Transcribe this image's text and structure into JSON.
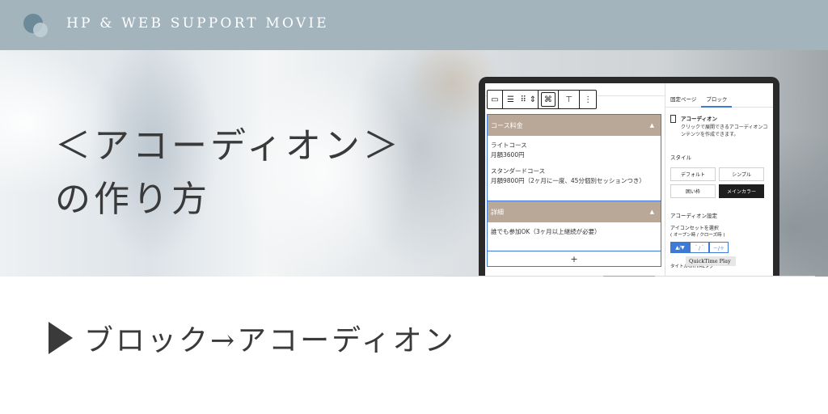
{
  "header": {
    "title": "HP & WEB SUPPORT MOVIE"
  },
  "hero": {
    "title_line1": "＜アコーディオン＞",
    "title_line2": "の作り方"
  },
  "editor": {
    "accordion1": {
      "heading": "コース料金",
      "lines": [
        "ライトコース",
        "月額3600円",
        "スタンダードコース",
        "月額9800円（2ヶ月に一度、45分個別セッションつき）"
      ]
    },
    "accordion2": {
      "heading": "詳細",
      "lines": [
        "誰でも参加OK（3ヶ月以上継続が必要）"
      ]
    },
    "add_label": "+"
  },
  "sidebar": {
    "tabs": [
      "固定ページ",
      "ブロック"
    ],
    "block_name": "アコーディオン",
    "block_desc": "クリックで展開できるアコーディオンコンテンツを作成できます。",
    "style_label": "スタイル",
    "styles": [
      "デフォルト",
      "シンプル",
      "囲い枠",
      "メインカラー"
    ],
    "accordion_settings_label": "アコーディオン設定",
    "iconset_label": "アイコンセットを選択",
    "iconset_sub": "( オープン時 / クローズ時 )",
    "icon_options": [
      "▲/▼",
      "＾/＾",
      "－/＋"
    ],
    "html_tag_label": "タイトルのHTMLタグ"
  },
  "overlay": {
    "quicktime": "QuickTime Play"
  },
  "bottom": {
    "heading": "ブロック→アコーディオン"
  },
  "colors": {
    "header_bg": "#a3b4bd",
    "accordion_head": "#b9a797",
    "selection_blue": "#3d7ad6"
  }
}
